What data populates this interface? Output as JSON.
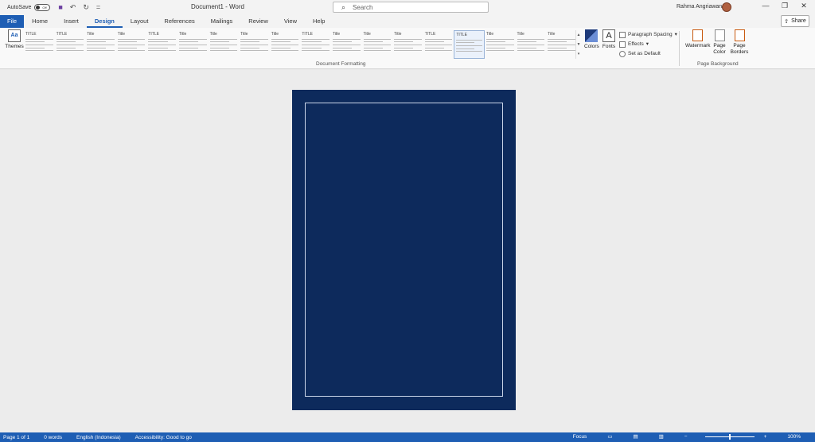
{
  "window": {
    "autosave_label": "AutoSave",
    "autosave_state": "Off",
    "doc_title": "Document1 - Word",
    "search_placeholder": "Search",
    "user_name": "Rahma Angriawan"
  },
  "tabs": [
    "File",
    "Home",
    "Insert",
    "Design",
    "Layout",
    "References",
    "Mailings",
    "Review",
    "View",
    "Help"
  ],
  "active_tab": "Design",
  "share_label": "Share",
  "ribbon": {
    "themes_label": "Themes",
    "doc_formatting_label": "Document Formatting",
    "styles": [
      {
        "title": "TITLE"
      },
      {
        "title": "TITLE"
      },
      {
        "title": "Title"
      },
      {
        "title": "Title"
      },
      {
        "title": "TITLE"
      },
      {
        "title": "Title"
      },
      {
        "title": "Title"
      },
      {
        "title": "Title"
      },
      {
        "title": "Title"
      },
      {
        "title": "TITLE"
      },
      {
        "title": "Title"
      },
      {
        "title": "Title"
      },
      {
        "title": "Title"
      },
      {
        "title": "TITLE"
      },
      {
        "title": "TITLE"
      },
      {
        "title": "Title"
      },
      {
        "title": "Title"
      },
      {
        "title": "Title"
      }
    ],
    "colors_label": "Colors",
    "fonts_label": "Fonts",
    "paragraph_spacing_label": "Paragraph Spacing",
    "effects_label": "Effects",
    "set_default_label": "Set as Default",
    "watermark_label": "Watermark",
    "page_color_label": "Page Color",
    "page_borders_label": "Page Borders",
    "page_background_label": "Page Background"
  },
  "status": {
    "page": "Page 1 of 1",
    "words": "0 words",
    "language": "English (Indonesia)",
    "accessibility": "Accessibility: Good to go",
    "focus": "Focus",
    "zoom": "100%"
  },
  "colors": {
    "page_bg": "#0d2a5c",
    "accent": "#1e5eb4"
  }
}
